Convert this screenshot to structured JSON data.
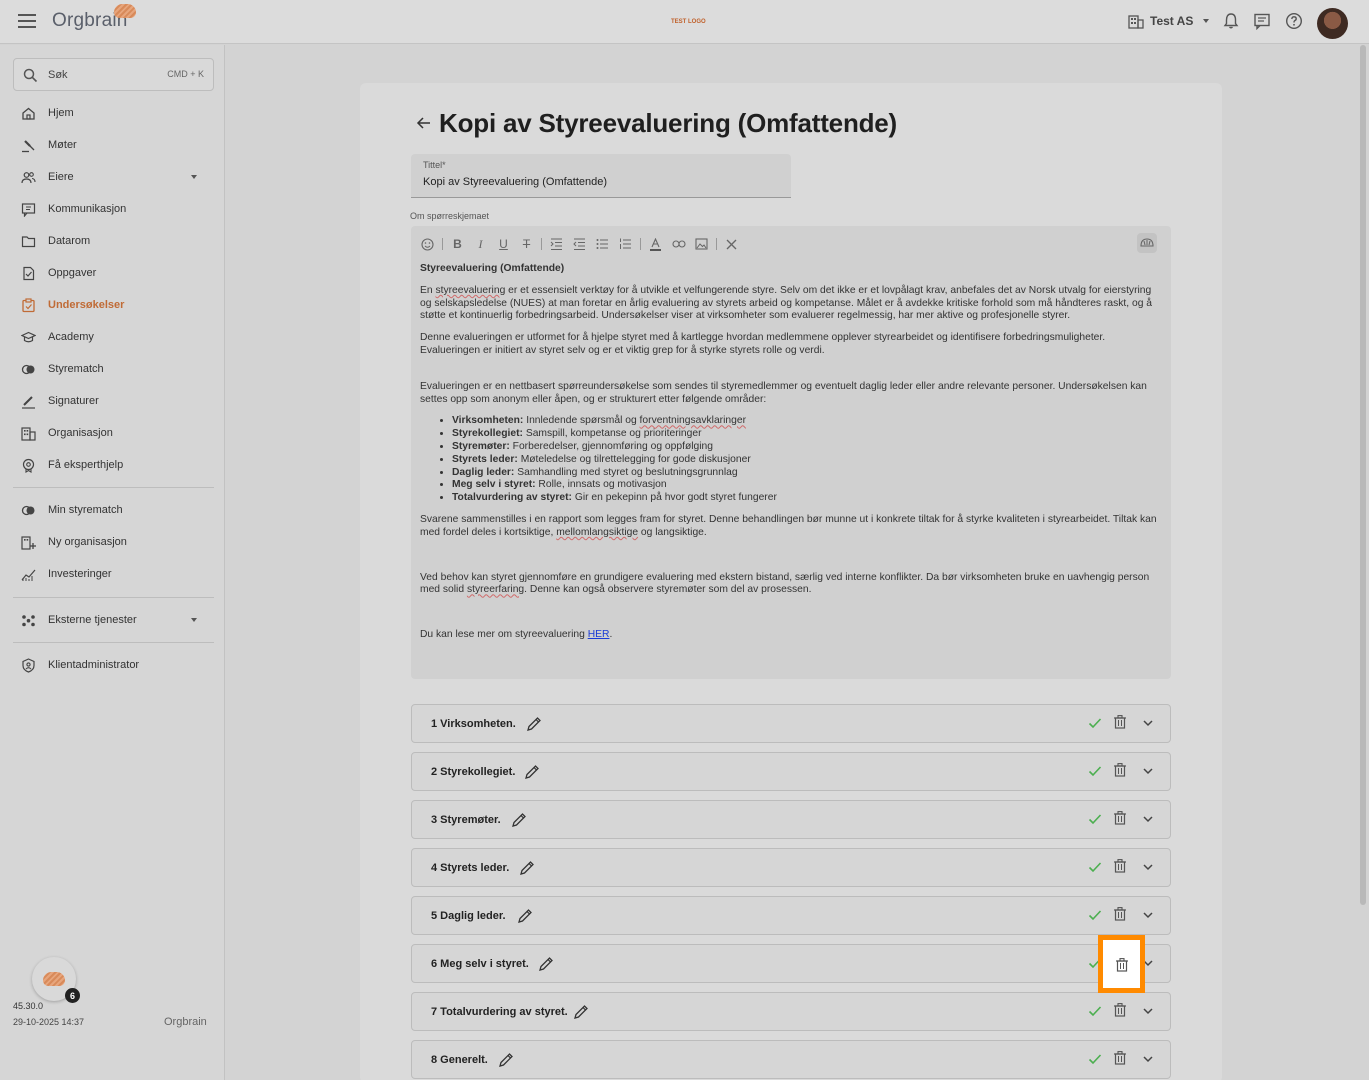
{
  "app": {
    "logo_text": "Orgbrain",
    "test_logo": "TEST LOGO",
    "company": "Test AS"
  },
  "search": {
    "label": "Søk",
    "shortcut": "CMD + K"
  },
  "sidebar": {
    "items": [
      {
        "label": "Hjem",
        "icon": "home-icon"
      },
      {
        "label": "Møter",
        "icon": "gavel-icon"
      },
      {
        "label": "Eiere",
        "icon": "people-icon"
      },
      {
        "label": "Kommunikasjon",
        "icon": "chat-icon"
      },
      {
        "label": "Datarom",
        "icon": "folder-icon"
      },
      {
        "label": "Oppgaver",
        "icon": "task-icon"
      },
      {
        "label": "Undersøkelser",
        "icon": "survey-icon"
      },
      {
        "label": "Academy",
        "icon": "academy-icon"
      },
      {
        "label": "Styrematch",
        "icon": "match-icon"
      },
      {
        "label": "Signaturer",
        "icon": "signature-icon"
      },
      {
        "label": "Organisasjon",
        "icon": "building-icon"
      },
      {
        "label": "Få eksperthjelp",
        "icon": "expert-icon"
      }
    ],
    "secondary": [
      {
        "label": "Min styrematch",
        "icon": "match-icon"
      },
      {
        "label": "Ny organisasjon",
        "icon": "new-org-icon"
      },
      {
        "label": "Investeringer",
        "icon": "chart-icon"
      }
    ],
    "external": {
      "label": "Eksterne tjenester",
      "icon": "services-icon"
    },
    "admin": {
      "label": "Klientadministrator",
      "icon": "shield-icon"
    },
    "badge_count": "6",
    "version": "45.30.0",
    "timestamp": "29-10-2025 14:37",
    "footer_logo": "Orgbrain"
  },
  "page": {
    "title": "Kopi av Styreevaluering (Omfattende)",
    "title_field_label": "Tittel*",
    "title_field_value": "Kopi av Styreevaluering (Omfattende)",
    "about_label": "Om spørreskjemaet"
  },
  "editor": {
    "heading": "Styreevaluering (Omfattende)",
    "p1_a": "En ",
    "p1_spell": "styreevaluering",
    "p1_b": " er et essensielt verktøy for å utvikle et velfungerende styre. Selv om det ikke er et lovpålagt krav, anbefales det av Norsk utvalg for eierstyring og selskapsledelse (NUES) at man foretar en årlig evaluering av styrets arbeid og kompetanse. Målet er å avdekke kritiske forhold som må håndteres raskt, og å støtte et kontinuerlig forbedringsarbeid. Undersøkelser viser at virksomheter som evaluerer regelmessig, har mer aktive og profesjonelle styrer.",
    "p2": "Denne evalueringen er utformet for å hjelpe styret med å kartlegge hvordan medlemmene opplever styrearbeidet og identifisere forbedringsmuligheter. Evalueringen er initiert av styret selv og er et viktig grep for å styrke styrets rolle og verdi.",
    "p3": "Evalueringen er en nettbasert spørreundersøkelse som sendes til styremedlemmer og eventuelt daglig leder eller andre relevante personer. Undersøkelsen kan settes opp som anonym eller åpen, og er strukturert etter følgende områder:",
    "bullets": [
      {
        "b": "Virksomheten:",
        "t": " Innledende spørsmål og ",
        "s": "forventningsavklaringer"
      },
      {
        "b": "Styrekollegiet:",
        "t": " Samspill, kompetanse og prioriteringer",
        "s": ""
      },
      {
        "b": "Styremøter:",
        "t": " Forberedelser, gjennomføring og oppfølging",
        "s": ""
      },
      {
        "b": "Styrets leder:",
        "t": " Møteledelse og tilrettelegging for gode diskusjoner",
        "s": ""
      },
      {
        "b": "Daglig leder:",
        "t": " Samhandling med styret og beslutningsgrunnlag",
        "s": ""
      },
      {
        "b": "Meg selv i styret:",
        "t": " Rolle, innsats og motivasjon",
        "s": ""
      },
      {
        "b": "Totalvurdering av styret:",
        "t": " Gir en pekepinn på hvor godt styret fungerer",
        "s": ""
      }
    ],
    "p4_a": "Svarene sammenstilles i en rapport som legges fram for styret. Denne behandlingen bør munne ut i konkrete tiltak for å styrke kvaliteten i styrearbeidet. Tiltak kan med fordel deles i kortsiktige, ",
    "p4_spell": "mellomlangsiktige",
    "p4_b": " og langsiktige.",
    "p5_a": "Ved behov kan styret gjennomføre en grundigere evaluering med ekstern bistand, særlig ved interne konflikter. Da bør virksomheten bruke en uavhengig person med solid ",
    "p5_spell": "styreerfaring",
    "p5_b": ". Denne kan også observere styremøter som del av prosessen.",
    "p6_a": "Du kan lese mer om styreevaluering ",
    "p6_link": "HER",
    "p6_b": "."
  },
  "sections": [
    {
      "label": "1 Virksomheten."
    },
    {
      "label": "2 Styrekollegiet."
    },
    {
      "label": "3 Styremøter."
    },
    {
      "label": "4 Styrets leder."
    },
    {
      "label": "5 Daglig leder."
    },
    {
      "label": "6 Meg selv i styret."
    },
    {
      "label": "7 Totalvurdering av styret."
    },
    {
      "label": "8 Generelt."
    }
  ],
  "colors": {
    "accent": "#c06b36",
    "highlight": "#ff8a00",
    "check": "#4caf50",
    "link": "#1a3bd6"
  }
}
